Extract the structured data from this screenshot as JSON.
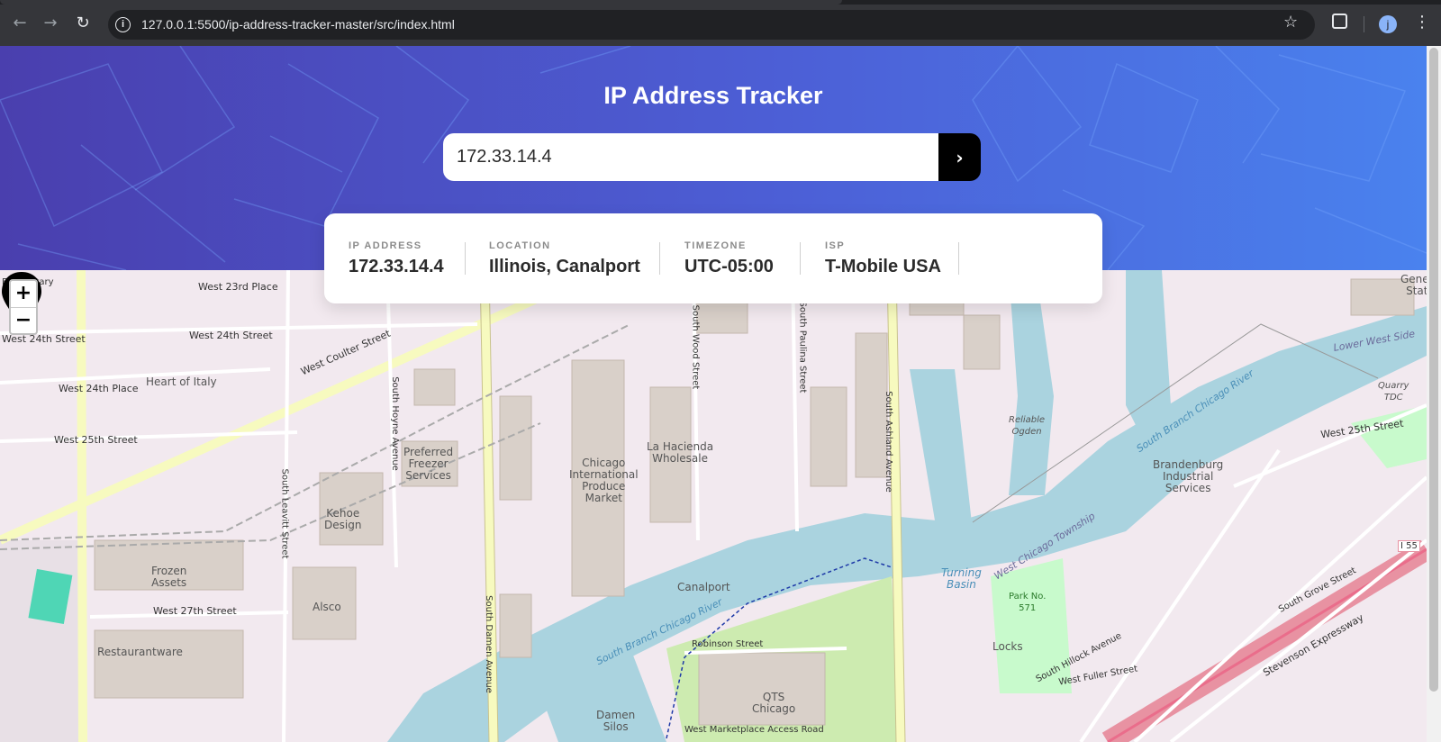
{
  "browser": {
    "url": "127.0.0.1:5500/ip-address-tracker-master/src/index.html",
    "avatar_letter": "j"
  },
  "header": {
    "title": "IP Address Tracker"
  },
  "search": {
    "value": "172.33.14.4",
    "button_label": "›"
  },
  "info": {
    "ip": {
      "label": "IP ADDRESS",
      "value": "172.33.14.4"
    },
    "location": {
      "label": "LOCATION",
      "value": "Illinois, Canalport"
    },
    "timezone": {
      "label": "TIMEZONE",
      "value": "UTC-05:00"
    },
    "isp": {
      "label": "ISP",
      "value": "T-Mobile USA"
    }
  },
  "map": {
    "zoom_in": "+",
    "zoom_out": "−",
    "labels": {
      "west_23rd_place": "West 23rd Place",
      "west_24th_street_1": "West 24th Street",
      "west_24th_street_2": "West 24th Street",
      "west_24th_place": "West 24th Place",
      "west_25th_street": "West 25th Street",
      "west_25th_street_east": "West 25th Street",
      "west_27th_street": "West 27th Street",
      "heart_of_italy": "Heart of Italy",
      "preferred_freezer": "Preferred\nFreezer\nServices",
      "chicago_produce": "Chicago\nInternational\nProduce\nMarket",
      "la_hacienda": "La Hacienda\nWholesale",
      "kehoe_design": "Kehoe\nDesign",
      "frozen_assets": "Frozen\nAssets",
      "alsco": "Alsco",
      "restaurantware": "Restaurantware",
      "canalport": "Canalport",
      "qts_chicago": "QTS\nChicago",
      "damen_silos": "Damen\nSilos",
      "robinson_street": "Robinson Street",
      "brandenburg": "Brandenburg\nIndustrial\nServices",
      "reliable_ogden": "Reliable\nOgden",
      "turning_basin": "Turning\nBasin",
      "park_571": "Park No.\n571",
      "locks": "Locks",
      "lower_west_side": "Lower West Side",
      "quarry_tdc": "Quarry\nTDC",
      "south_branch": "South Branch Chicago River",
      "south_branch_2": "South Branch Chicago River",
      "west_chicago_township": "West Chicago Township",
      "stevenson": "Stevenson Expressway",
      "i55": "I 55",
      "south_damen": "South Damen Avenue",
      "south_ashland": "South Ashland Avenue",
      "south_wood": "South Wood Street",
      "south_paulina": "South Paulina Street",
      "south_hoyne": "South Hoyne Avenue",
      "south_leavitt": "South Leavitt Street",
      "west_coulter": "West Coulter Street",
      "south_grove": "South Grove Street",
      "south_hillock": "South Hillock Avenue",
      "west_fuller": "West Fuller Street",
      "marketplace": "West Marketplace Access Road",
      "general_stat": "Gener\nStat",
      "elementary": "Elementary"
    }
  }
}
